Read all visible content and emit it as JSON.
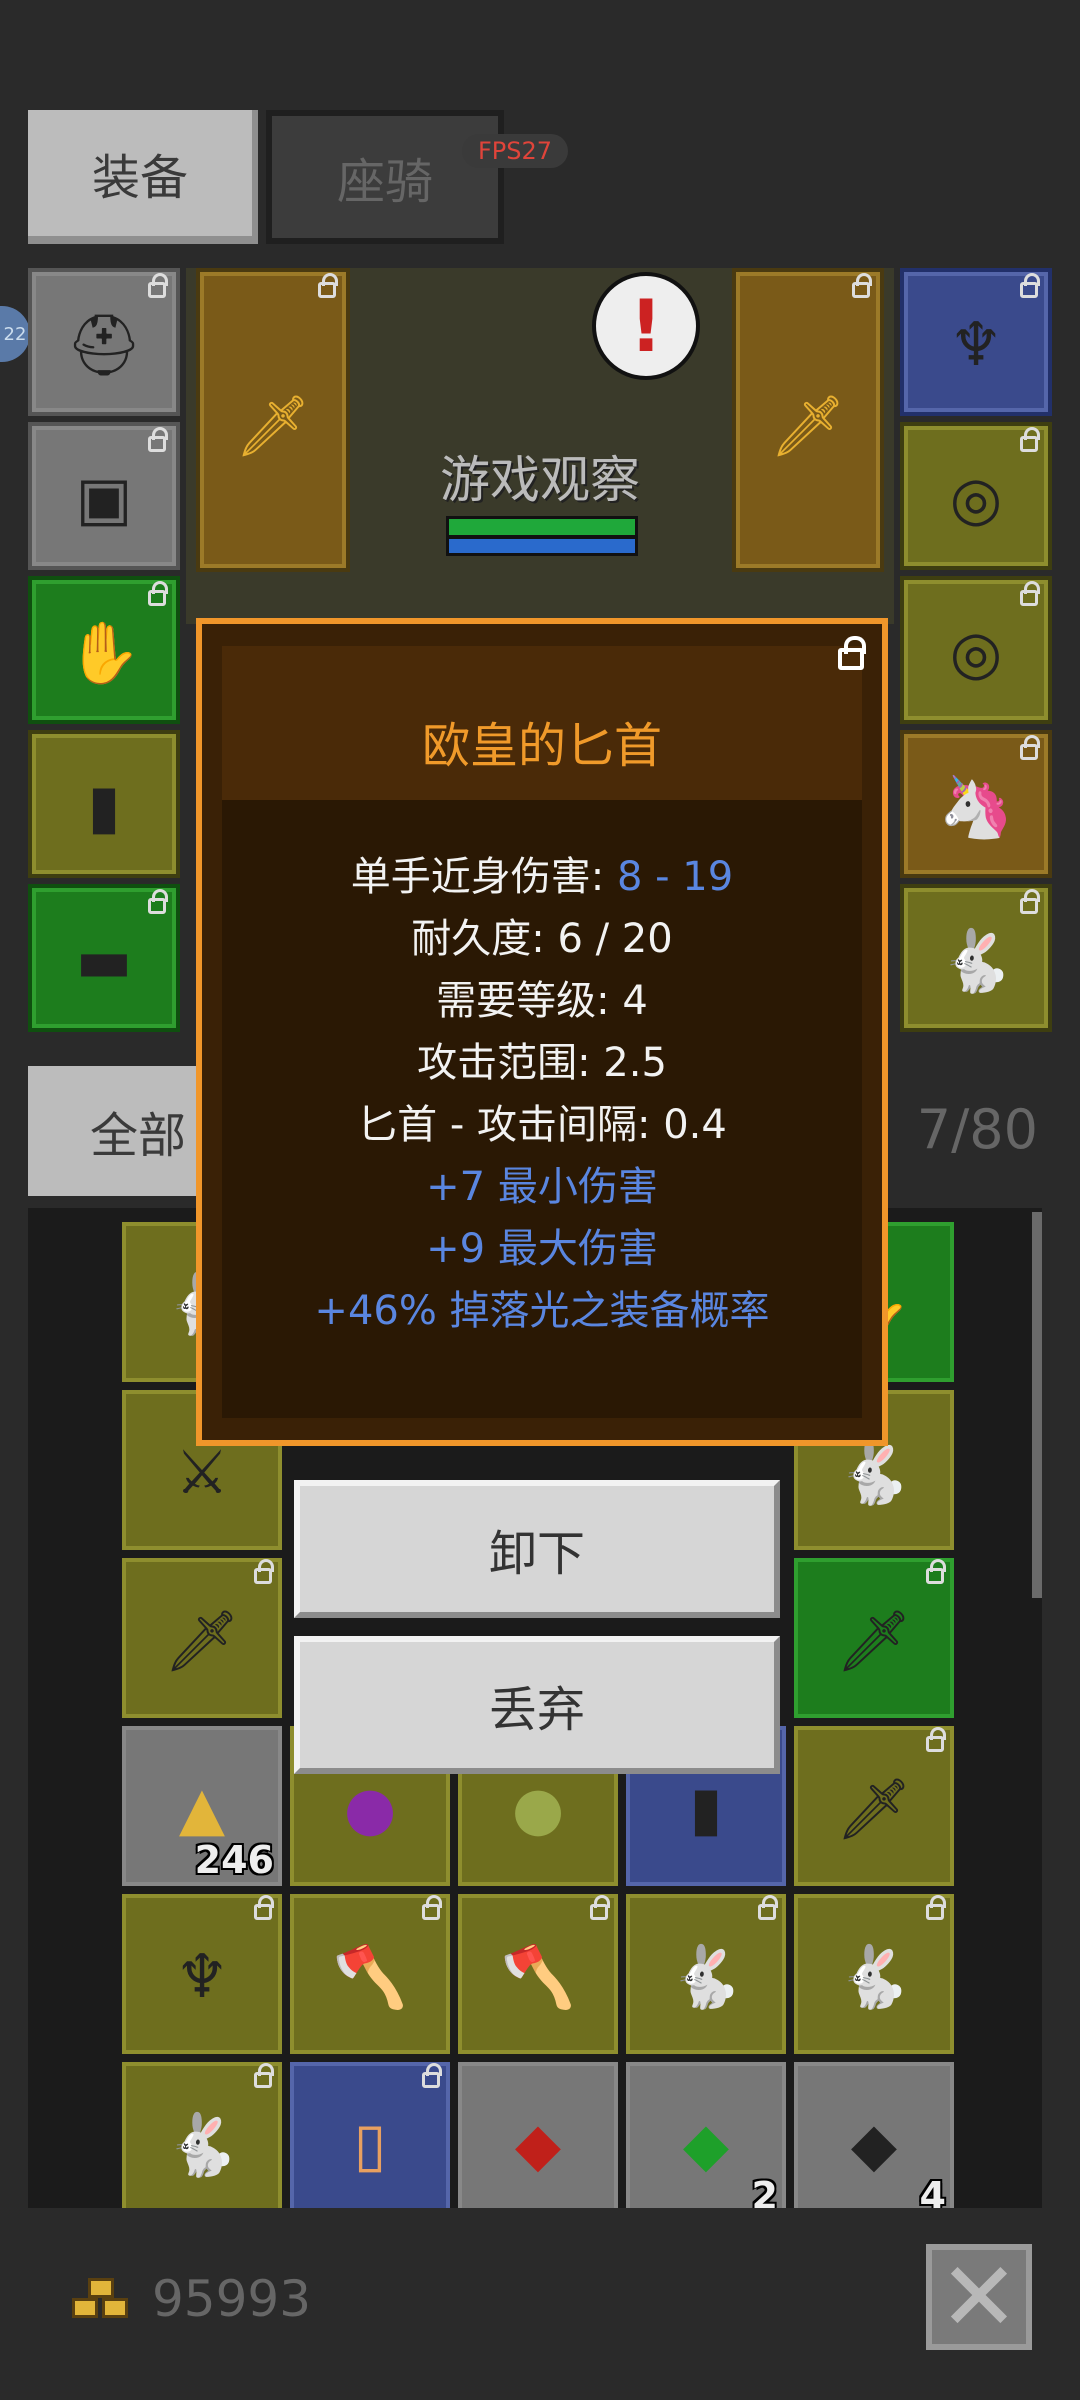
{
  "tabs": {
    "equipment": "装备",
    "mount": "座骑"
  },
  "fps": "FPS27",
  "side_badge": "22",
  "scene": {
    "player_label": "游戏观察",
    "alert_glyph": "!"
  },
  "filter": {
    "all_label": "全部",
    "count": "7/80"
  },
  "tooltip": {
    "title": "欧皇的匕首",
    "stats": [
      {
        "label": "单手近身伤害: ",
        "value": "8 - 19"
      },
      {
        "text": "耐久度: 6 / 20"
      },
      {
        "text": "需要等级: 4"
      },
      {
        "text": "攻击范围: 2.5"
      },
      {
        "text": "匕首 - 攻击间隔: 0.4"
      }
    ],
    "bonuses": [
      "+7 最小伤害",
      "+9 最大伤害",
      "+46% 掉落光之装备概率"
    ]
  },
  "actions": {
    "unequip": "卸下",
    "drop": "丢弃"
  },
  "inventory": {
    "quantities": {
      "gold_pile": "246",
      "green_gem": "2",
      "dark_gem": "4"
    }
  },
  "currency": {
    "gold": "95993"
  },
  "colors": {
    "tooltip_border": "#f0962a",
    "title": "#f09a2a",
    "bonus": "#5a86e0"
  }
}
